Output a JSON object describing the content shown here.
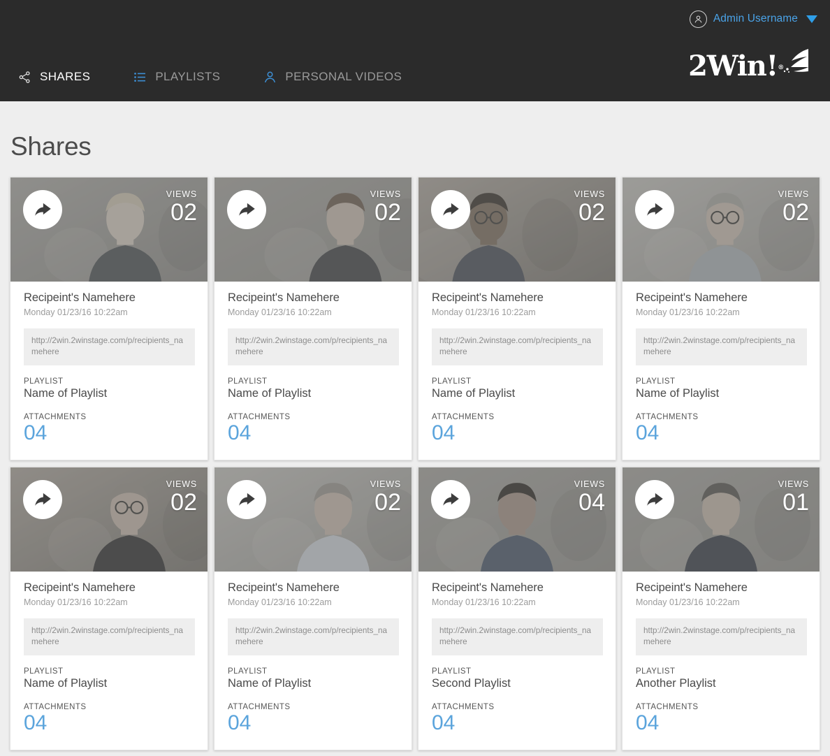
{
  "header": {
    "account": {
      "icon": "user-circle-icon",
      "name": "Admin Username",
      "caret": "chevron-down-icon"
    },
    "logo": {
      "text": "2Win!",
      "trademark": "®",
      "icon": "wing-swoosh-icon"
    },
    "nav": [
      {
        "id": "shares",
        "label": "SHARES",
        "icon": "share-nodes-icon",
        "active": true
      },
      {
        "id": "playlists",
        "label": "PLAYLISTS",
        "icon": "list-icon",
        "active": false
      },
      {
        "id": "personal-videos",
        "label": "PERSONAL VIDEOS",
        "icon": "person-icon",
        "active": false
      }
    ]
  },
  "page": {
    "title": "Shares",
    "labels": {
      "views": "VIEWS",
      "playlist": "PLAYLIST",
      "attachments": "ATTACHMENTS"
    }
  },
  "colors": {
    "accent_blue": "#5ba4dc",
    "link_blue": "#4aa3e8",
    "header_bg": "#2b2b2b",
    "page_bg": "#eeeeee",
    "card_bg": "#ffffff"
  },
  "cards": [
    {
      "recipient": "Recipeint's Namehere",
      "timestamp": "Monday 01/23/16 10:22am",
      "url": "http://2win.2winstage.com/p/recipients_namehere",
      "playlist": "Name of Playlist",
      "attachments": "04",
      "views": "02",
      "thumb": "woman-blonde-office"
    },
    {
      "recipient": "Recipeint's Namehere",
      "timestamp": "Monday 01/23/16 10:22am",
      "url": "http://2win.2winstage.com/p/recipients_namehere",
      "playlist": "Name of Playlist",
      "attachments": "04",
      "views": "02",
      "thumb": "woman-curly-blazer"
    },
    {
      "recipient": "Recipeint's Namehere",
      "timestamp": "Monday 01/23/16 10:22am",
      "url": "http://2win.2winstage.com/p/recipients_namehere",
      "playlist": "Name of Playlist",
      "attachments": "04",
      "views": "02",
      "thumb": "man-glasses-suit"
    },
    {
      "recipient": "Recipeint's Namehere",
      "timestamp": "Monday 01/23/16 10:22am",
      "url": "http://2win.2winstage.com/p/recipients_namehere",
      "playlist": "Name of Playlist",
      "attachments": "04",
      "views": "02",
      "thumb": "man-grey-hair-glasses"
    },
    {
      "recipient": "Recipeint's Namehere",
      "timestamp": "Monday 01/23/16 10:22am",
      "url": "http://2win.2winstage.com/p/recipients_namehere",
      "playlist": "Name of Playlist",
      "attachments": "04",
      "views": "02",
      "thumb": "man-bald-glasses-brick"
    },
    {
      "recipient": "Recipeint's Namehere",
      "timestamp": "Monday 01/23/16 10:22am",
      "url": "http://2win.2winstage.com/p/recipients_namehere",
      "playlist": "Name of Playlist",
      "attachments": "04",
      "views": "02",
      "thumb": "man-blue-shirt-seated"
    },
    {
      "recipient": "Recipeint's Namehere",
      "timestamp": "Monday 01/23/16 10:22am",
      "url": "http://2win.2winstage.com/p/recipients_namehere",
      "playlist": "Second Playlist",
      "attachments": "04",
      "views": "04",
      "thumb": "woman-dark-hair-blue-dress"
    },
    {
      "recipient": "Recipeint's Namehere",
      "timestamp": "Monday 01/23/16 10:22am",
      "url": "http://2win.2winstage.com/p/recipients_namehere",
      "playlist": "Another Playlist",
      "attachments": "04",
      "views": "01",
      "thumb": "man-beard-navy-suit"
    }
  ]
}
